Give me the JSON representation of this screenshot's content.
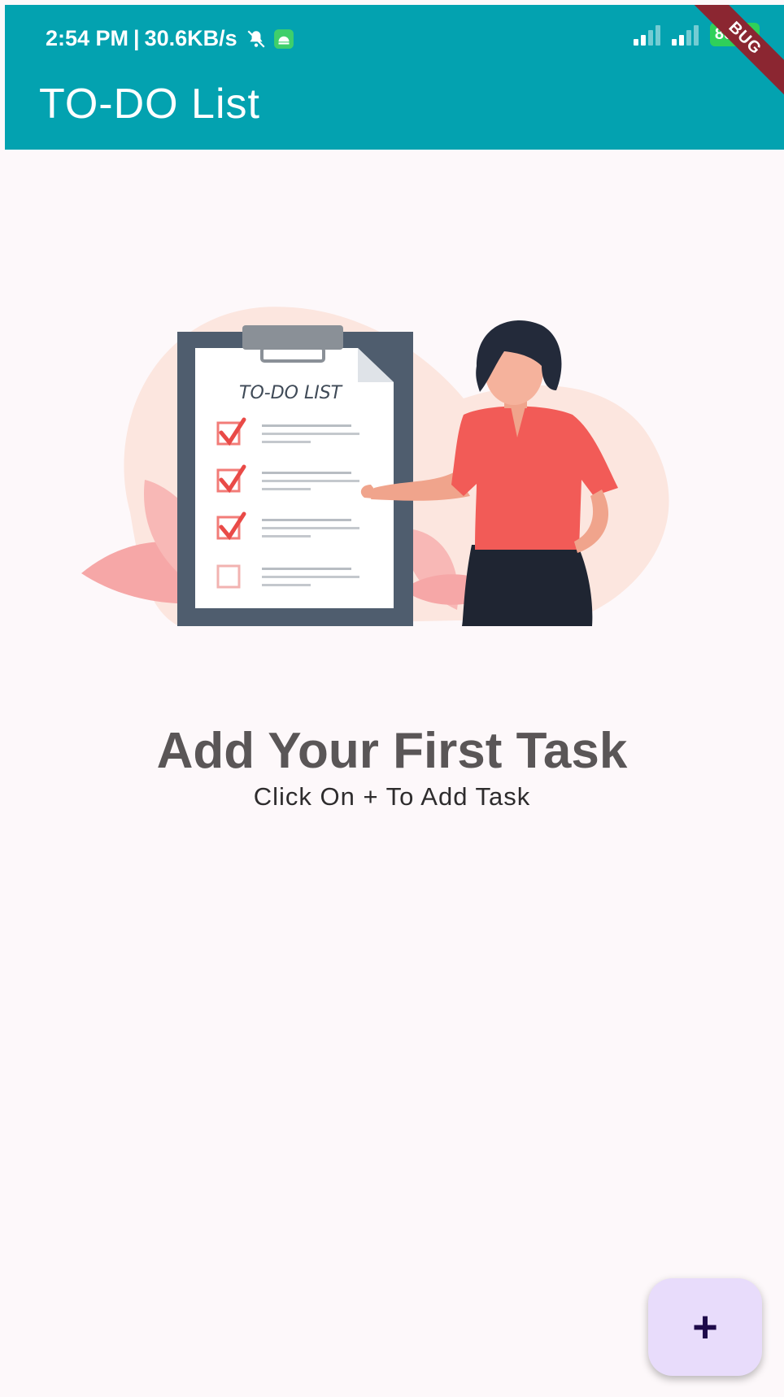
{
  "status_bar": {
    "time": "2:54 PM",
    "separator": "|",
    "network_speed": "30.6KB/s",
    "battery_level": "86",
    "icons": [
      "mute-icon",
      "android-app-icon",
      "signal-icon",
      "signal-icon",
      "battery-charging-icon"
    ]
  },
  "app_bar": {
    "title": "TO-DO List",
    "background_color": "#03a2b0"
  },
  "debug_banner": "BUG",
  "illustration": {
    "clipboard_heading": "TO-DO LIST",
    "checklist": [
      true,
      true,
      true,
      false
    ],
    "accent_color": "#f25b57"
  },
  "empty_state": {
    "title": "Add Your First Task",
    "subtitle": "Click On + To Add Task"
  },
  "fab": {
    "label": "+",
    "icon": "plus-icon"
  }
}
